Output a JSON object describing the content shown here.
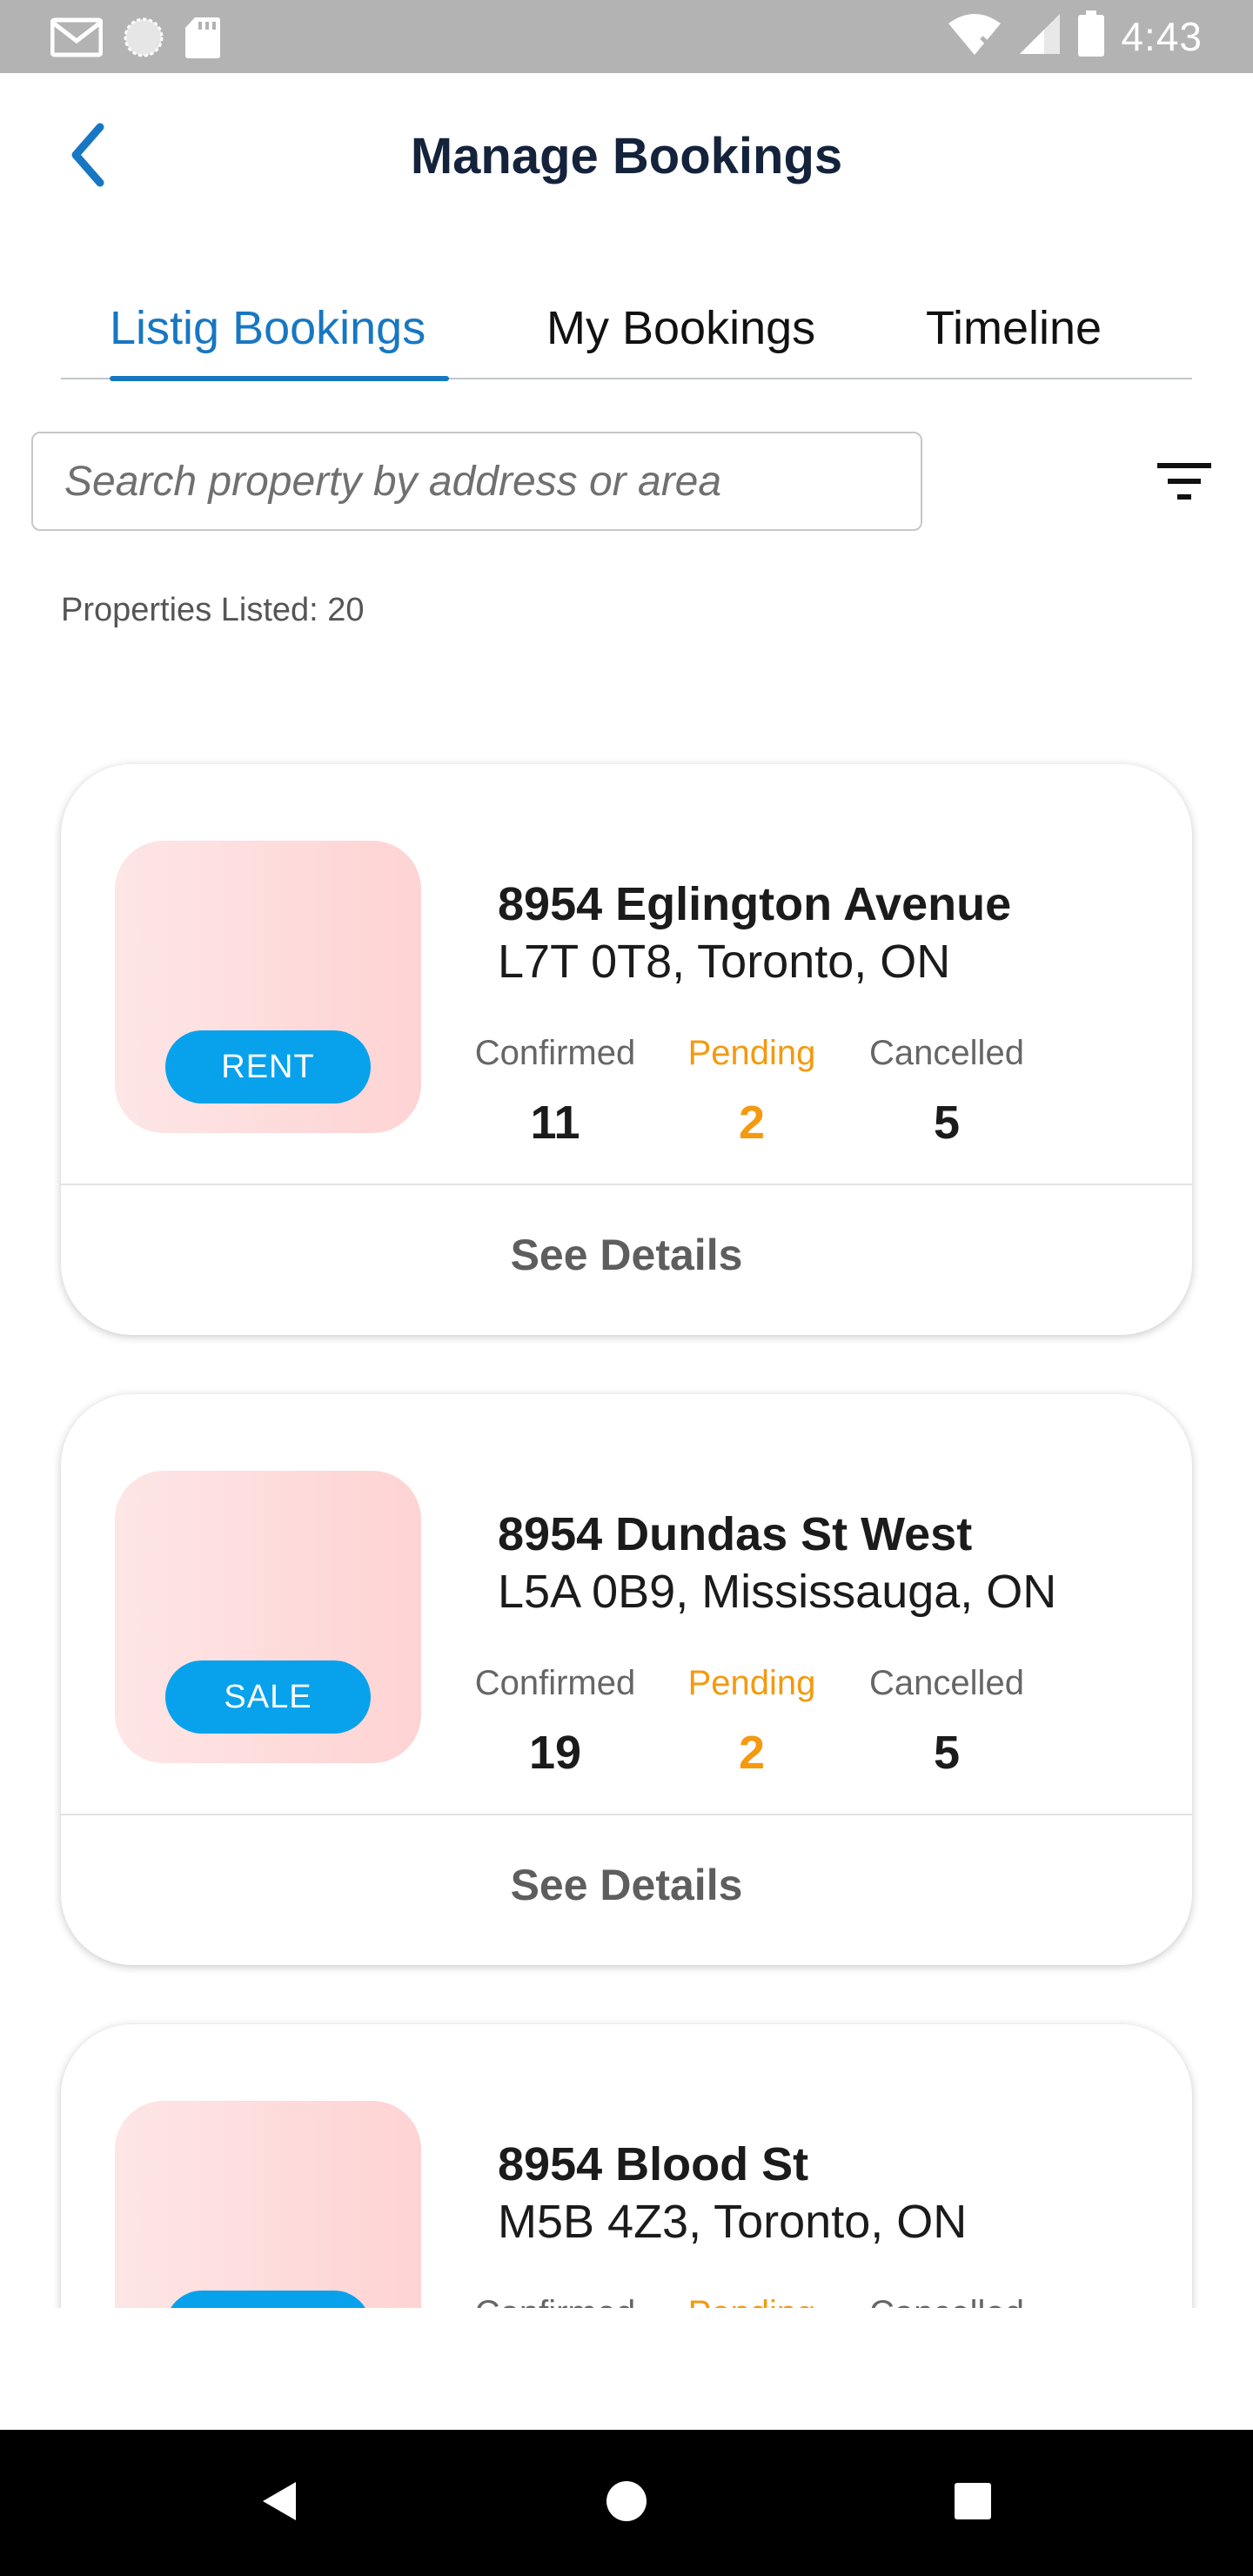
{
  "status_bar": {
    "time": "4:43",
    "left_icons": [
      "gmail-icon",
      "sync-icon",
      "sd-card-icon"
    ],
    "right_icons": [
      "wifi-off-icon",
      "signal-icon",
      "battery-icon"
    ]
  },
  "header": {
    "title": "Manage Bookings",
    "back_icon": "chevron-left-icon"
  },
  "tabs": [
    {
      "label": "Listig Bookings",
      "active": true
    },
    {
      "label": "My Bookings",
      "active": false
    },
    {
      "label": "Timeline",
      "active": false
    }
  ],
  "search": {
    "placeholder": "Search property by address or area",
    "value": ""
  },
  "filter_icon": "filter-icon",
  "properties_count": "Properties Listed: 20",
  "stat_labels": {
    "confirmed": "Confirmed",
    "pending": "Pending",
    "cancelled": "Cancelled"
  },
  "details_label": "See Details",
  "cards": [
    {
      "badge": "RENT",
      "address_line1": "8954 Eglington Avenue",
      "address_line2": "L7T 0T8, Toronto, ON",
      "confirmed": "11",
      "pending": "2",
      "cancelled": "5"
    },
    {
      "badge": "SALE",
      "address_line1": "8954 Dundas St West",
      "address_line2": "L5A 0B9, Mississauga, ON",
      "confirmed": "19",
      "pending": "2",
      "cancelled": "5"
    },
    {
      "badge": "",
      "address_line1": "8954 Blood St",
      "address_line2": "M5B 4Z3, Toronto, ON",
      "confirmed": "",
      "pending": "",
      "cancelled": ""
    }
  ],
  "colors": {
    "accent": "#1877c2",
    "badge": "#08a2ec",
    "pending": "#f39a10",
    "status_bar": "#b3b3b3"
  },
  "nav_bar": [
    "back-triangle-icon",
    "home-circle-icon",
    "recents-square-icon"
  ]
}
